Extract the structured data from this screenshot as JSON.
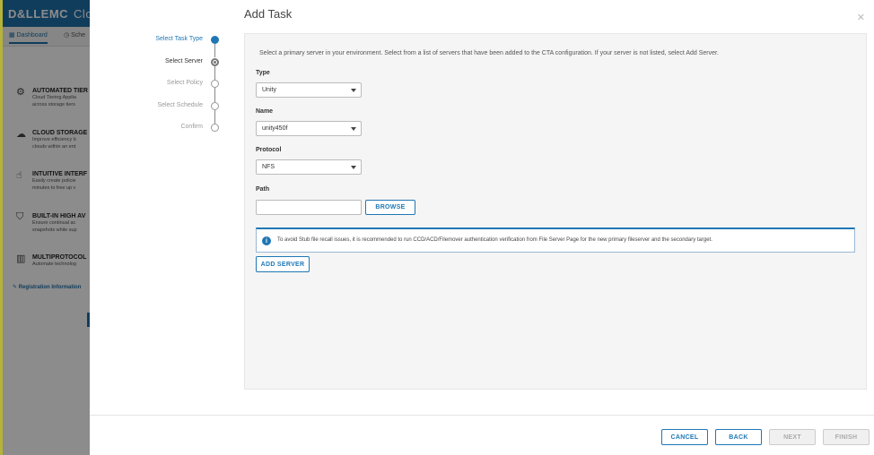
{
  "background": {
    "logo_brand": "D&LLEMC",
    "logo_product": "Clou",
    "nav": {
      "dashboard": "Dashboard",
      "schedule": "Sche"
    },
    "features": [
      {
        "title": "AUTOMATED TIER",
        "desc1": "Cloud Tiering Applia",
        "desc2": "across storage tiers",
        "icon": "automation-icon"
      },
      {
        "title": "CLOUD STORAGE",
        "desc1": "Improve efficiency b",
        "desc2": "clouds within an ent",
        "icon": "cloud-storage-icon"
      },
      {
        "title": "INTUITIVE INTERF",
        "desc1": "Easily create policie",
        "desc2": "minutes to free up v",
        "icon": "hand-pointer-icon"
      },
      {
        "title": "BUILT-IN HIGH AV",
        "desc1": "Ensure continual ac",
        "desc2": "snapshots while sup",
        "icon": "shield-icon"
      },
      {
        "title": "MULTIPROTOCOL",
        "desc1": "Automate technolog",
        "desc2": "",
        "icon": "server-rack-icon"
      }
    ],
    "registration_link": "Registration Information"
  },
  "modal": {
    "title": "Add Task",
    "close_glyph": "✕",
    "steps": [
      {
        "label": "Select Task Type",
        "state": "current"
      },
      {
        "label": "Select Server",
        "state": "done"
      },
      {
        "label": "Select Policy",
        "state": "todo"
      },
      {
        "label": "Select Schedule",
        "state": "todo"
      },
      {
        "label": "Confirm",
        "state": "todo"
      }
    ],
    "intro": "Select a primary server in your environment. Select from a list of servers that have been added to the CTA configuration. If your server is not listed, select Add Server.",
    "fields": {
      "type": {
        "label": "Type",
        "value": "Unity"
      },
      "name": {
        "label": "Name",
        "value": "unity450f"
      },
      "protocol": {
        "label": "Protocol",
        "value": "NFS"
      },
      "path": {
        "label": "Path",
        "value": ""
      }
    },
    "browse_label": "BROWSE",
    "info": {
      "icon_glyph": "i",
      "text": "To avoid Stub file recall issues, it is recommended to run CCD/ACD/Filemover authentication verification from File Server Page for the new primary fileserver and the secondary target."
    },
    "add_server_label": "ADD SERVER",
    "footer": {
      "cancel": "CANCEL",
      "back": "BACK",
      "next": "NEXT",
      "finish": "FINISH"
    }
  },
  "colors": {
    "accent": "#1f77b4",
    "header": "#1f6fa8"
  }
}
